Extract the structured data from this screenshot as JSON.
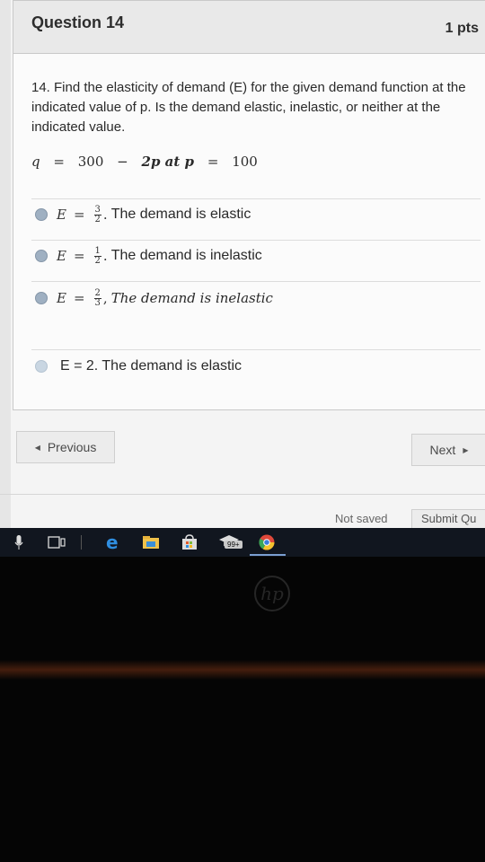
{
  "question": {
    "title": "Question 14",
    "points": "1 pts",
    "text": "14. Find the elasticity of demand (E) for the given demand function at the indicated value of p. Is the demand elastic, inelastic, or neither at the indicated value.",
    "formula": {
      "q": "q",
      "eq": "=",
      "a": "300",
      "minus": "−",
      "b": "2p at p",
      "eq2": "=",
      "c": "100"
    }
  },
  "answers": [
    {
      "E": "E",
      "eq": "=",
      "num": "3",
      "den": "2",
      "sep": ".",
      "text": "The demand is elastic"
    },
    {
      "E": "E",
      "eq": "=",
      "num": "1",
      "den": "2",
      "sep": ".",
      "text": "The demand is inelastic"
    },
    {
      "E": "E",
      "eq": "=",
      "num": "2",
      "den": "3",
      "sep": ",",
      "text": "The demand is inelastic"
    },
    {
      "text": "E = 2. The demand is elastic"
    }
  ],
  "nav": {
    "previous": "Previous",
    "next": "Next"
  },
  "footer": {
    "status": "Not saved",
    "submit": "Submit Qu"
  },
  "taskbar": {
    "badge": "99+"
  },
  "brand": {
    "logo": "hp"
  },
  "colors": {
    "radio": "#9fb0c2",
    "taskbar": "#11161f"
  }
}
